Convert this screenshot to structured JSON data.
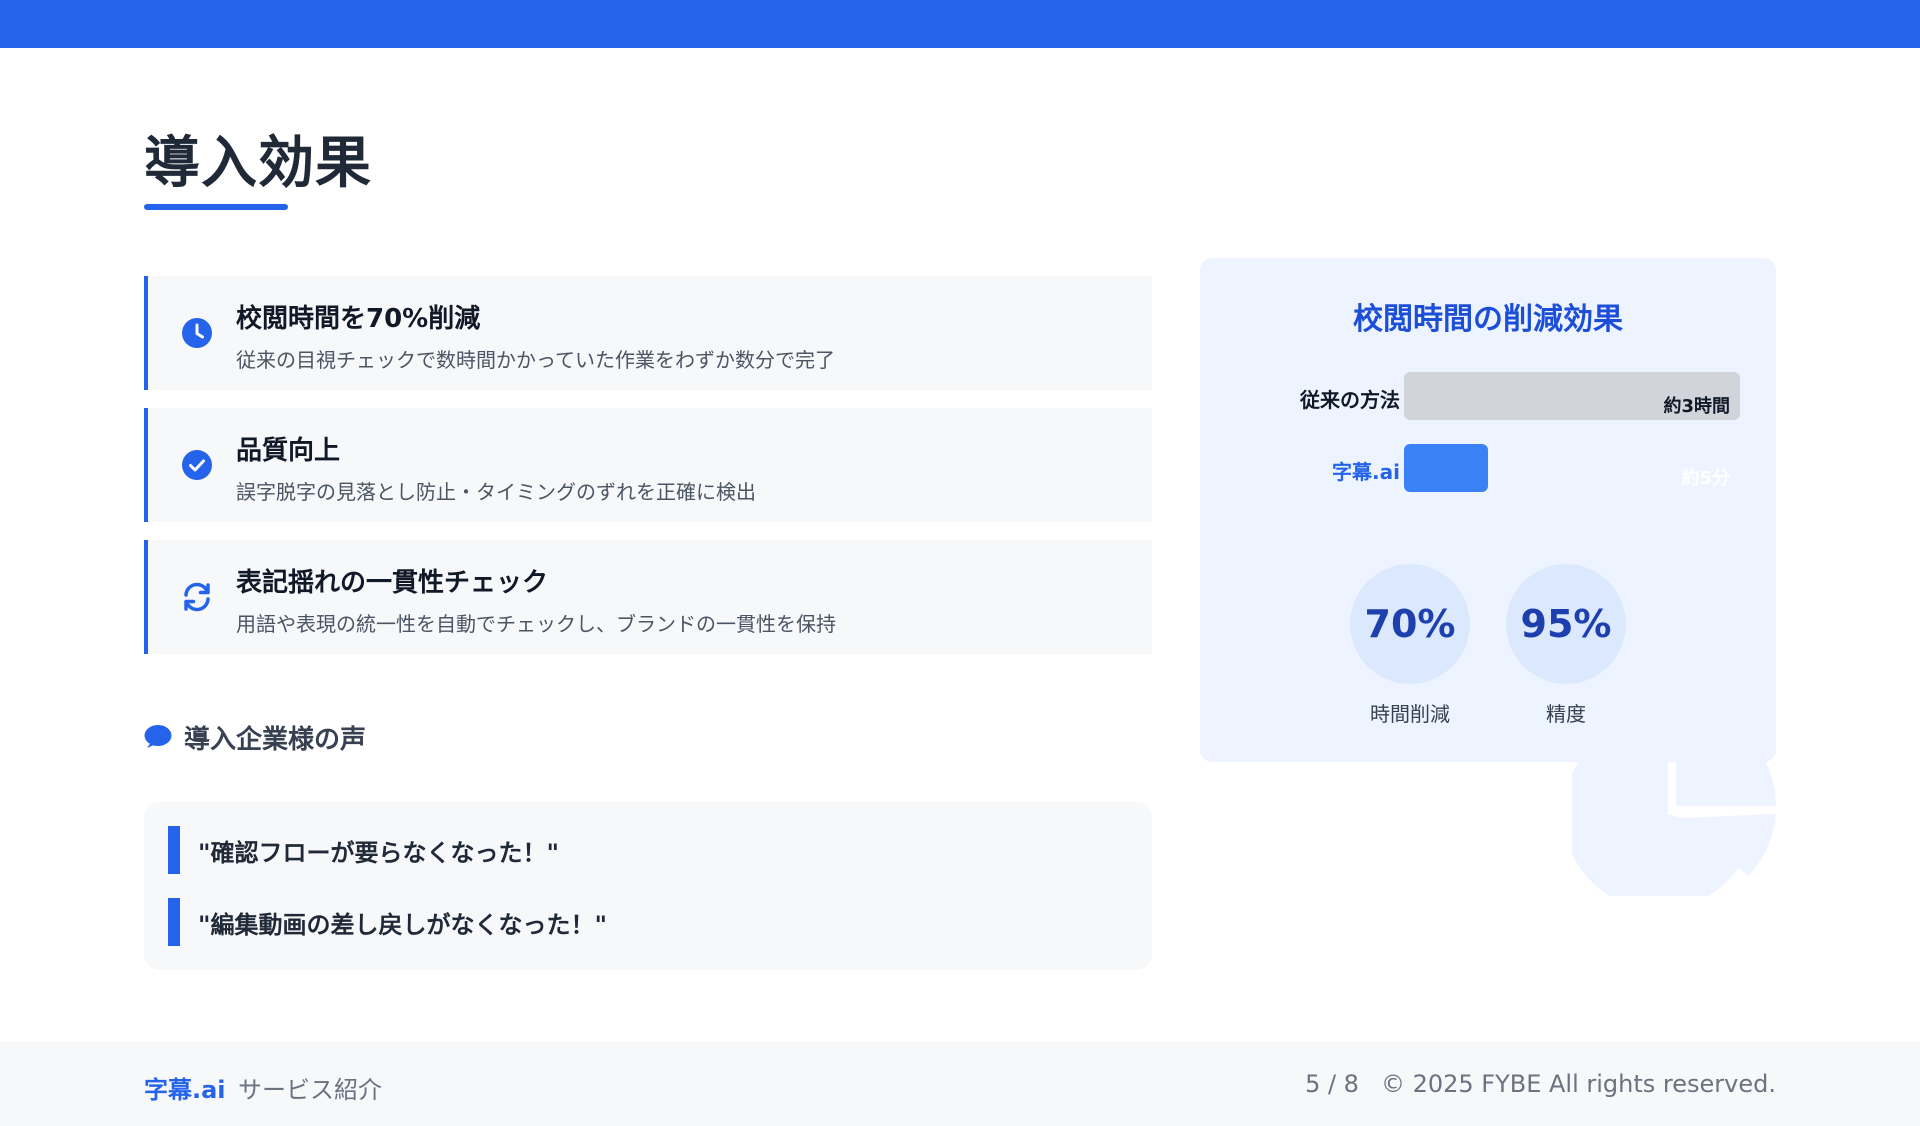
{
  "page": {
    "title": "導入効果"
  },
  "colors": {
    "accent": "#2563eb",
    "panel": "#eef4ff",
    "card": "#f7f8fa",
    "stat_bg": "#dbe8fd"
  },
  "features": [
    {
      "icon": "clock-icon",
      "title": "校閲時間を70%削減",
      "desc": "従来の目視チェックで数時間かかっていた作業をわずか数分で完了"
    },
    {
      "icon": "check-circle-icon",
      "title": "品質向上",
      "desc": "誤字脱字の見落とし防止・タイミングのずれを正確に検出"
    },
    {
      "icon": "sync-icon",
      "title": "表記揺れの一貫性チェック",
      "desc": "用語や表現の統一性を自動でチェックし、ブランドの一貫性を保持"
    }
  ],
  "voices": {
    "icon": "comment-icon",
    "heading": "導入企業様の声",
    "quotes": [
      "\"確認フローが要らなくなった！\"",
      "\"編集動画の差し戻しがなくなった！\""
    ]
  },
  "effect": {
    "title": "校閲時間の削減効果",
    "bars": [
      {
        "label": "従来の方法",
        "value_text": "約3時間",
        "fraction": 1.0
      },
      {
        "label": "字幕.ai",
        "value_text": "約5分",
        "fraction": 0.25
      }
    ],
    "stats": [
      {
        "value": "70%",
        "label": "時間削減"
      },
      {
        "value": "95%",
        "label": "精度"
      }
    ],
    "deco_icon": "pie-chart-icon"
  },
  "footer": {
    "brand": "字幕.ai",
    "subtitle": "サービス紹介",
    "page_indicator": "5 / 8",
    "copyright": "© 2025 FYBE All rights reserved."
  }
}
